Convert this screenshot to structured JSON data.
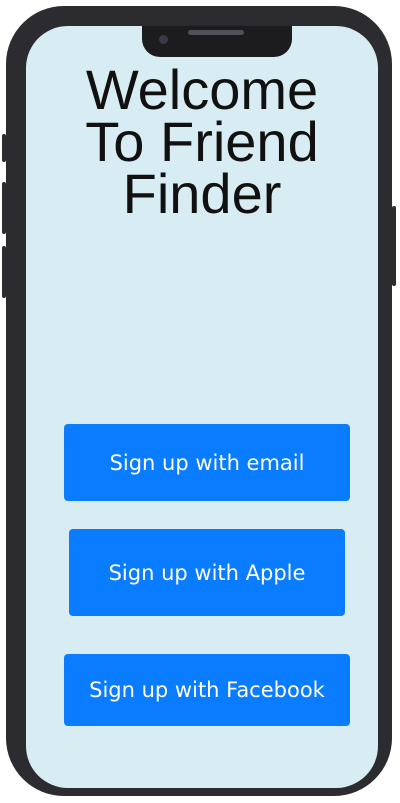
{
  "screen": {
    "title_lines": [
      "Welcome",
      "To Friend",
      "Finder"
    ]
  },
  "actions": {
    "email_label": "Sign up with email",
    "apple_label": "Sign up with Apple",
    "facebook_label": "Sign up with Facebook"
  },
  "colors": {
    "background": "#d8ecf3",
    "button": "#0a7cff",
    "button_text": "#ffffff",
    "title_text": "#111111",
    "phone_frame": "#2b2b30"
  }
}
